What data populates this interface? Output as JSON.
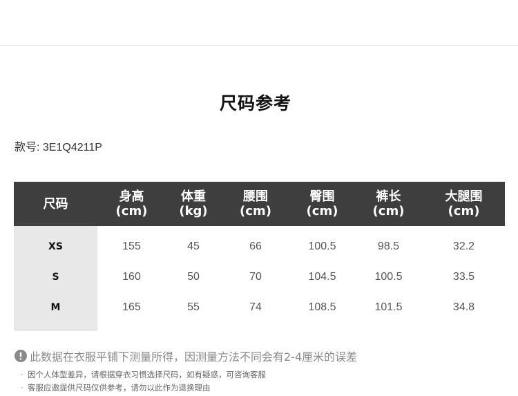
{
  "page": {
    "title": "尺码参考",
    "style_label": "款号:",
    "style_number": "3E1Q4211P"
  },
  "table": {
    "headers": [
      {
        "name": "尺码",
        "unit": ""
      },
      {
        "name": "身高",
        "unit": "(cm)"
      },
      {
        "name": "体重",
        "unit": "(kg)"
      },
      {
        "name": "腰围",
        "unit": "(cm)"
      },
      {
        "name": "臀围",
        "unit": "(cm)"
      },
      {
        "name": "裤长",
        "unit": "(cm)"
      },
      {
        "name": "大腿围",
        "unit": "(cm)"
      }
    ],
    "rows": [
      [
        "XS",
        "155",
        "45",
        "66",
        "100.5",
        "98.5",
        "32.2"
      ],
      [
        "S",
        "160",
        "50",
        "70",
        "104.5",
        "100.5",
        "33.5"
      ],
      [
        "M",
        "165",
        "55",
        "74",
        "108.5",
        "101.5",
        "34.8"
      ]
    ]
  },
  "notes": {
    "icon": "exclamation-circle-icon",
    "main": "此数据在衣服平铺下测量所得，因测量方法不同会有2-4厘米的误差",
    "items": [
      "因个人体型差异，请根据穿衣习惯选择尺码，如有疑惑，可咨询客服",
      "客服应邀提供尺码仅供参考，请勿以此作为退换理由"
    ]
  },
  "colors": {
    "header_bg": "#3e3e3e",
    "size_col_bg": "#e8e8e8"
  }
}
